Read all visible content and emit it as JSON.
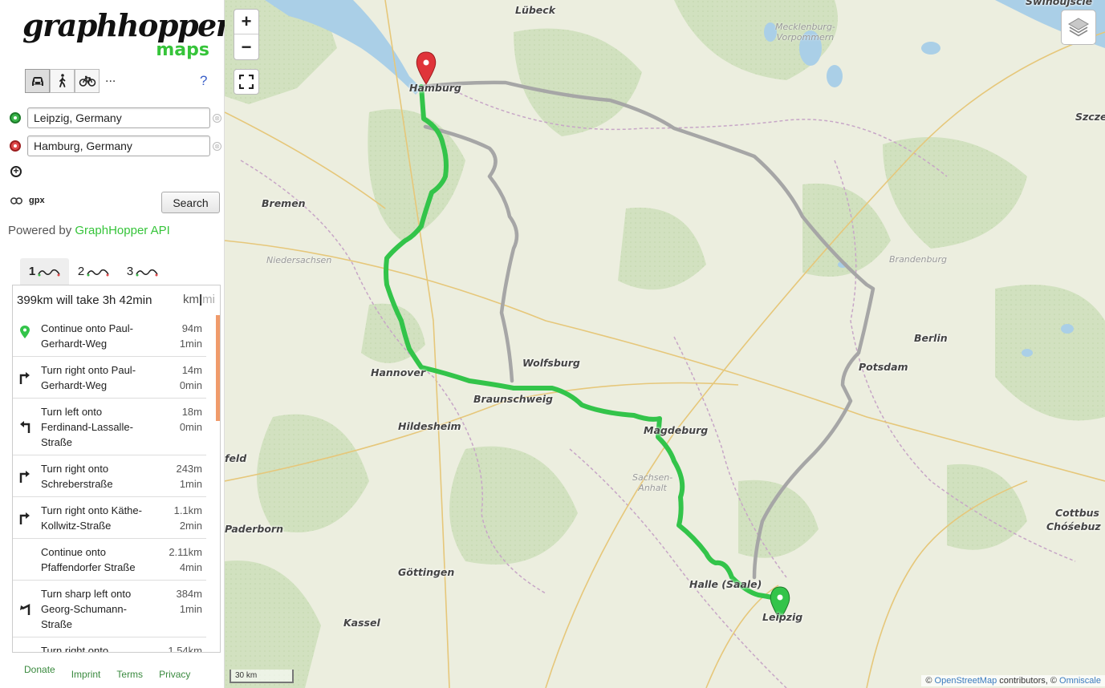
{
  "app": {
    "logo_main": "graphhopper",
    "logo_sub": "maps",
    "vehicles": [
      {
        "name": "car",
        "icon": "car-icon",
        "active": true
      },
      {
        "name": "foot",
        "icon": "walking-person-icon",
        "active": false
      },
      {
        "name": "bike",
        "icon": "bicycle-icon",
        "active": false
      }
    ],
    "more_label": "...",
    "help_label": "?"
  },
  "route_inputs": {
    "start": {
      "value": "Leipzig, Germany",
      "color": "#3ab54a"
    },
    "end": {
      "value": "Hamburg, Germany",
      "color": "#e0494b"
    },
    "clear_symbol": "⊗",
    "add_symbol": "+"
  },
  "actions": {
    "gpx_label": "gpx",
    "search_label": "Search"
  },
  "powered": {
    "prefix": "Powered by",
    "link_text": "GraphHopper API"
  },
  "alternatives": [
    {
      "label": "1",
      "active": true
    },
    {
      "label": "2",
      "active": false
    },
    {
      "label": "3",
      "active": false
    }
  ],
  "summary": {
    "text": "399km will take 3h 42min",
    "unit_km": "km",
    "unit_sep": "|",
    "unit_mi": "mi"
  },
  "instructions": [
    {
      "icon": "green-pin-icon",
      "text": "Continue onto Paul-Gerhardt-Weg",
      "distance": "94m",
      "time": "1min"
    },
    {
      "icon": "turn-right-icon",
      "text": "Turn right onto Paul-Gerhardt-Weg",
      "distance": "14m",
      "time": "0min"
    },
    {
      "icon": "turn-left-icon",
      "text": "Turn left onto Ferdinand-Lassalle-Straße",
      "distance": "18m",
      "time": "0min"
    },
    {
      "icon": "turn-right-icon",
      "text": "Turn right onto Schreberstraße",
      "distance": "243m",
      "time": "1min"
    },
    {
      "icon": "turn-right-icon",
      "text": "Turn right onto Käthe-Kollwitz-Straße",
      "distance": "1.1km",
      "time": "2min"
    },
    {
      "icon": "continue-icon",
      "text": "Continue onto Pfaffendorfer Straße",
      "distance": "2.11km",
      "time": "4min"
    },
    {
      "icon": "turn-sharp-left-icon",
      "text": "Turn sharp left onto Georg-Schumann-Straße",
      "distance": "384m",
      "time": "1min"
    },
    {
      "icon": "turn-right-icon",
      "text": "Turn right onto",
      "distance": "1.54km",
      "time": ""
    }
  ],
  "footer": {
    "donate": "Donate",
    "imprint": "Imprint",
    "terms": "Terms",
    "privacy": "Privacy"
  },
  "map": {
    "zoom_in": "+",
    "zoom_out": "−",
    "scale_label": "30 km",
    "attribution_prefix": "©",
    "attribution_osm": "OpenStreetMap",
    "attribution_mid": "contributors, ©",
    "attribution_tiles": "Omniscale",
    "route_color": "#33c44a",
    "alt_route_color": "#a6a6a6",
    "cities": [
      "Lübeck",
      "Hamburg",
      "Bremen",
      "Hannover",
      "Wolfsburg",
      "Braunschweig",
      "Hildesheim",
      "Magdeburg",
      "Berlin",
      "Potsdam",
      "Halle (Saale)",
      "Leipzig",
      "Göttingen",
      "Kassel",
      "Paderborn",
      "feld",
      "Cottbus",
      "Chóśebuz",
      "Szcze",
      "Swinoujscie"
    ],
    "regions": [
      "Mecklenburg-",
      "Vorpommern",
      "Niedersachsen",
      "Brandenburg",
      "Sachsen-",
      "Anhalt"
    ]
  }
}
